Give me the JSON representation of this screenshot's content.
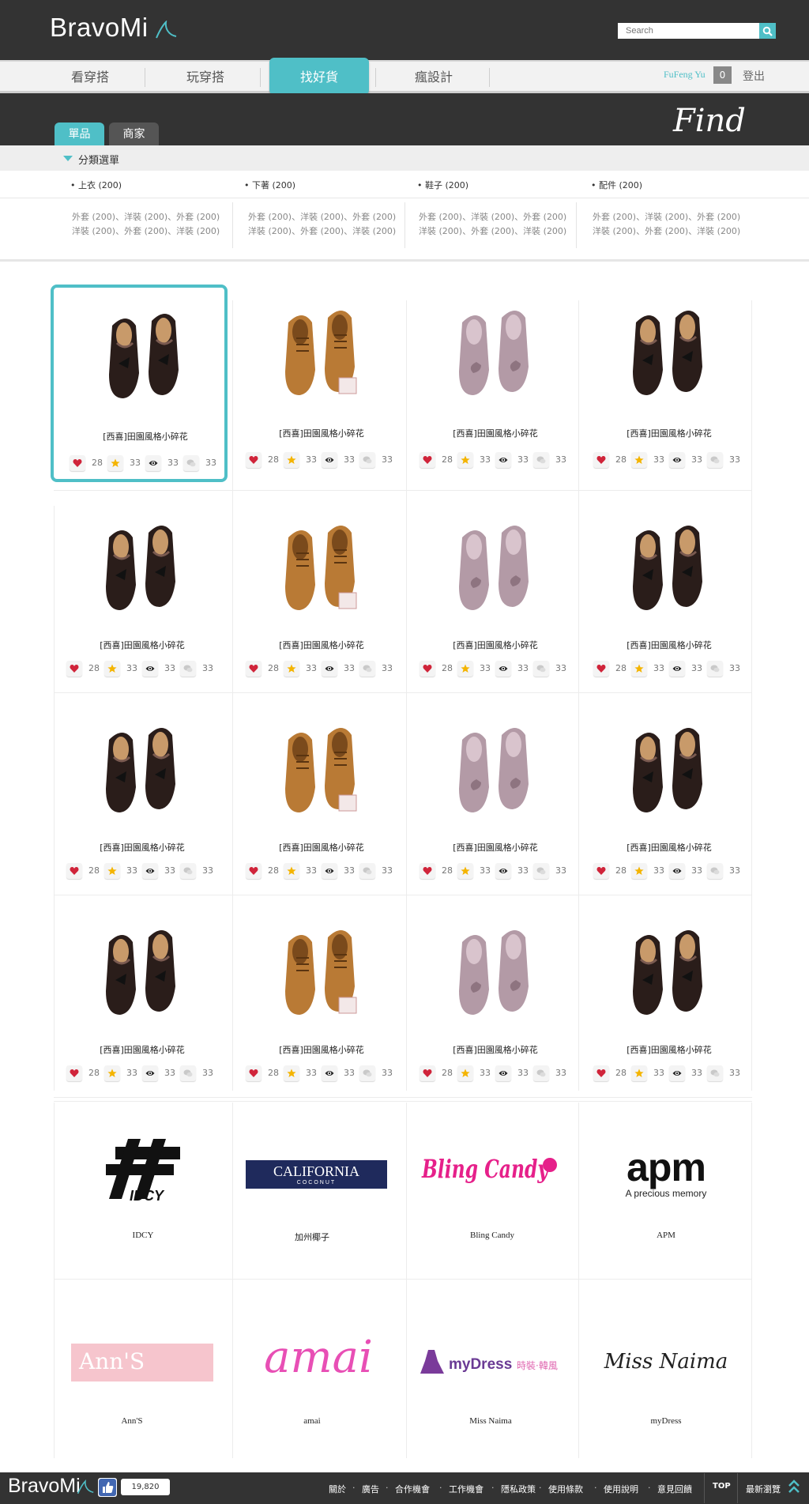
{
  "header": {
    "logo": "BravoMi",
    "search_placeholder": "Search",
    "nav": [
      "看穿搭",
      "玩穿搭",
      "找好貨",
      "瘋設計"
    ],
    "active_nav": "找好貨",
    "user_name": "FuFeng Yu",
    "user_count": "0",
    "logout": "登出"
  },
  "band": {
    "tabs": [
      "單品",
      "商家"
    ],
    "title": "Find"
  },
  "categories": {
    "title": "分類選單",
    "main": [
      "上衣 (200)",
      "下著 (200)",
      "鞋子 (200)",
      "配件 (200)"
    ],
    "sub_line1": "外套 (200)、洋裝 (200)、外套 (200)",
    "sub_line2": "洋裝 (200)、外套 (200)、洋裝 (200)"
  },
  "product_title": "[西喜]田園風格小碎花",
  "product_types": [
    "black",
    "brown",
    "pink",
    "black"
  ],
  "stats": {
    "likes": "28",
    "stars": "33",
    "views": "33",
    "comments": "33"
  },
  "brands": [
    {
      "logo": "IDCY",
      "name": "IDCY"
    },
    {
      "logo": "CALIFORNIA",
      "logo_sub": "COCONUT",
      "name": "加州椰子"
    },
    {
      "logo": "Bling Candy",
      "name": "Bling Candy"
    },
    {
      "logo": "apm",
      "logo_sub": "A precious memory",
      "name": "APM"
    },
    {
      "logo": "Ann'S",
      "name": "Ann'S"
    },
    {
      "logo": "amai",
      "name": "amai"
    },
    {
      "logo": "myDress",
      "name": "Miss Naima"
    },
    {
      "logo": "Miss Naima",
      "name": "myDress"
    }
  ],
  "footer": {
    "logo": "BravoMi",
    "like_count": "19,820",
    "links": [
      "關於",
      "廣告",
      "合作機會",
      "工作機會",
      "隱私政策",
      "使用條款",
      "使用說明",
      "意見回饋"
    ],
    "top": "TOP",
    "latest": "最新瀏覽"
  },
  "colors": {
    "accent": "#4fbfc7",
    "dark": "#333333",
    "heart": "#d0243a",
    "star": "#f4b400"
  }
}
